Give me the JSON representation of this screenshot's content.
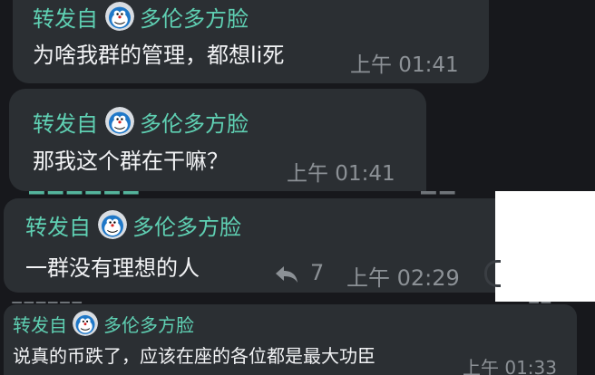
{
  "messages": [
    {
      "forward_label": "转发自",
      "forward_name": "多伦多方脸",
      "text": "为啥我群的管理，都想li死",
      "time": "上午 01:41"
    },
    {
      "forward_label": "转发自",
      "forward_name": "多伦多方脸",
      "text": "那我这个群在干嘛？",
      "time": "上午 01:41"
    },
    {
      "forward_label": "转发自",
      "forward_name": "多伦多方脸",
      "text": "一群没有理想的人",
      "forward_count": "7",
      "time": "上午 02:29"
    },
    {
      "forward_label": "转发自",
      "forward_name": "多伦多方脸",
      "text": "说真的币跌了，应该在座的各位都是最大功臣",
      "time": "上午 01:33"
    }
  ],
  "colors": {
    "bubble": "#2b2f33",
    "background": "#17181c",
    "accent": "#5fd0b3",
    "time": "#8c9196"
  },
  "icons": {
    "avatar": "doraemon-avatar-icon",
    "forward": "share-forward-icon"
  }
}
